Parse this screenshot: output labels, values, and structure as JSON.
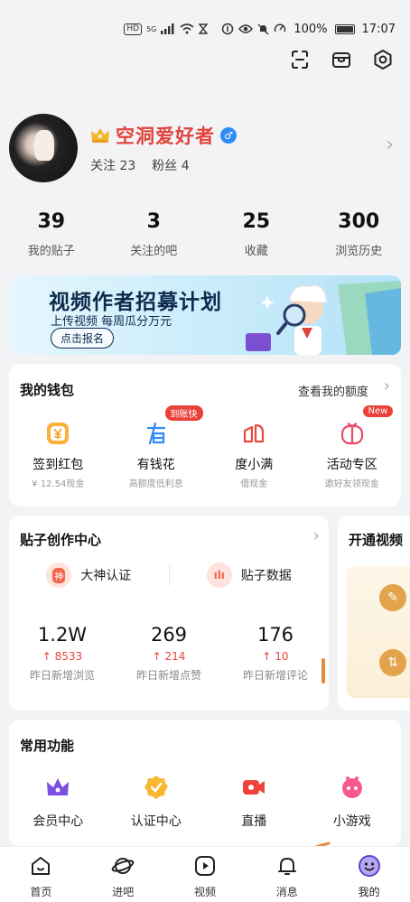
{
  "status_bar": {
    "network_labels": [
      "HD",
      "5G"
    ],
    "battery": "100%",
    "time": "17:07"
  },
  "top_actions": [
    "scan-icon",
    "box-icon",
    "settings-icon"
  ],
  "profile": {
    "name": "空洞爱好者",
    "verified_icon": "male-badge-icon",
    "following_label": "关注 23",
    "fans_label": "粉丝 4"
  },
  "stats": [
    {
      "value": "39",
      "label": "我的贴子"
    },
    {
      "value": "3",
      "label": "关注的吧"
    },
    {
      "value": "25",
      "label": "收藏"
    },
    {
      "value": "300",
      "label": "浏览历史"
    }
  ],
  "banner": {
    "title": "视频作者招募计划",
    "subtitle": "上传视频 每周瓜分万元",
    "button": "点击报名"
  },
  "wallet": {
    "title": "我的钱包",
    "link": "查看我的额度",
    "items": [
      {
        "label": "签到红包",
        "sub": "¥ 12.54现金",
        "icon": "yuan-icon",
        "badge": ""
      },
      {
        "label": "有钱花",
        "sub": "高额度低利息",
        "icon": "youqianhua-icon",
        "badge": "到账快"
      },
      {
        "label": "度小满",
        "sub": "借现金",
        "icon": "duxiaoman-icon",
        "badge": ""
      },
      {
        "label": "活动专区",
        "sub": "邀好友领现金",
        "icon": "gift-icon",
        "badge": "New"
      }
    ]
  },
  "creation": {
    "title": "贴子创作中心",
    "tags": [
      {
        "label": "大神认证",
        "icon_text": "神"
      },
      {
        "label": "贴子数据",
        "icon_text": "ılı"
      }
    ],
    "stats": [
      {
        "value": "1.2W",
        "delta": "↑ 8533",
        "label": "昨日新增浏览"
      },
      {
        "value": "269",
        "delta": "↑ 214",
        "label": "昨日新增点赞"
      },
      {
        "value": "176",
        "delta": "↑ 10",
        "label": "昨日新增评论"
      }
    ]
  },
  "video_card": {
    "title": "开通视频"
  },
  "common": {
    "title": "常用功能",
    "items": [
      {
        "label": "会员中心",
        "icon": "crown-icon"
      },
      {
        "label": "认证中心",
        "icon": "certify-icon"
      },
      {
        "label": "直播",
        "icon": "live-camera-icon"
      },
      {
        "label": "小游戏",
        "icon": "game-icon"
      }
    ]
  },
  "tabs": [
    {
      "label": "首页",
      "icon": "home-icon"
    },
    {
      "label": "进吧",
      "icon": "planet-icon"
    },
    {
      "label": "视频",
      "icon": "video-play-icon"
    },
    {
      "label": "消息",
      "icon": "bell-icon"
    },
    {
      "label": "我的",
      "icon": "smile-face-icon"
    }
  ],
  "colors": {
    "accent_red": "#e0433b",
    "brand_blue": "#2f8bf4",
    "orange": "#e2a34a",
    "active_tab": "#7b62e0"
  }
}
